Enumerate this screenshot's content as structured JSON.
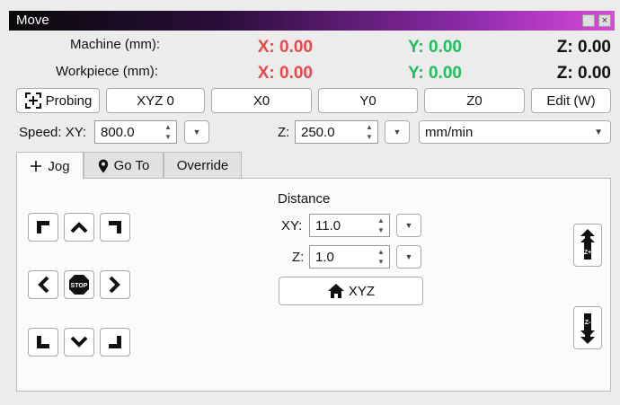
{
  "window": {
    "title": "Move"
  },
  "machine": {
    "label": "Machine (mm):",
    "x": "X: 0.00",
    "y": "Y: 0.00",
    "z": "Z: 0.00"
  },
  "workpiece": {
    "label": "Workpiece (mm):",
    "x": "X: 0.00",
    "y": "Y: 0.00",
    "z": "Z: 0.00"
  },
  "toolbar": {
    "probing": "Probing",
    "xyz0": "XYZ 0",
    "x0": "X0",
    "y0": "Y0",
    "z0": "Z0",
    "edit": "Edit (W)"
  },
  "speed": {
    "xy_label": "Speed: XY:",
    "xy_value": "800.0",
    "z_label": "Z:",
    "z_value": "250.0",
    "unit": "mm/min"
  },
  "tabs": [
    {
      "label": "Jog"
    },
    {
      "label": "Go To"
    },
    {
      "label": "Override"
    }
  ],
  "jog": {
    "distance_label": "Distance",
    "xy_label": "XY:",
    "xy_value": "11.0",
    "z_label": "Z:",
    "z_value": "1.0",
    "home_label": "XYZ",
    "stop_text": "STOP",
    "zplus_text": "Z+",
    "zminus_text": "Z-"
  },
  "icons": {
    "probing": "probe-target-icon",
    "home": "home-icon",
    "stop": "stop-sign-icon",
    "jog_tab": "plus-icon",
    "goto_tab": "map-pin-icon"
  },
  "colors": {
    "x_axis": "#e8484a",
    "y_axis": "#1fbe5e",
    "z_axis": "#111111"
  }
}
